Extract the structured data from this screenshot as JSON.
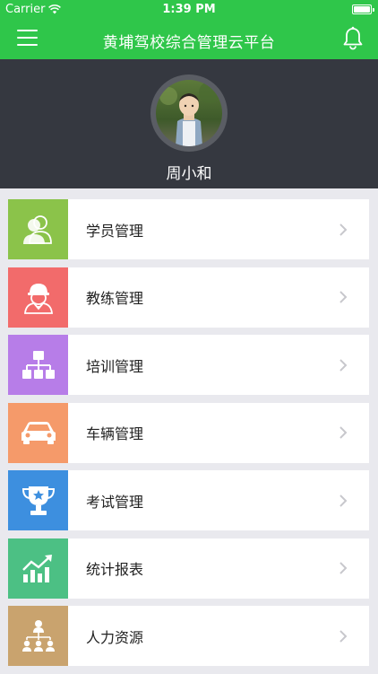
{
  "status_bar": {
    "carrier": "Carrier",
    "time": "1:39 PM"
  },
  "nav": {
    "title": "黄埔驾校综合管理云平台",
    "menu_icon": "hamburger-menu-icon",
    "bell_icon": "bell-icon"
  },
  "profile": {
    "name": "周小和"
  },
  "menu": [
    {
      "label": "学员管理",
      "icon": "students-icon",
      "color": "#8bc34a"
    },
    {
      "label": "教练管理",
      "icon": "coach-icon",
      "color": "#f26b6b"
    },
    {
      "label": "培训管理",
      "icon": "org-chart-icon",
      "color": "#b77de8"
    },
    {
      "label": "车辆管理",
      "icon": "car-icon",
      "color": "#f59a6a"
    },
    {
      "label": "考试管理",
      "icon": "trophy-icon",
      "color": "#3d8fdf"
    },
    {
      "label": "统计报表",
      "icon": "chart-icon",
      "color": "#4cc084"
    },
    {
      "label": "人力资源",
      "icon": "hierarchy-icon",
      "color": "#c9a36e"
    }
  ],
  "colors": {
    "brand_green": "#2fc64a",
    "profile_bg": "#353840"
  }
}
